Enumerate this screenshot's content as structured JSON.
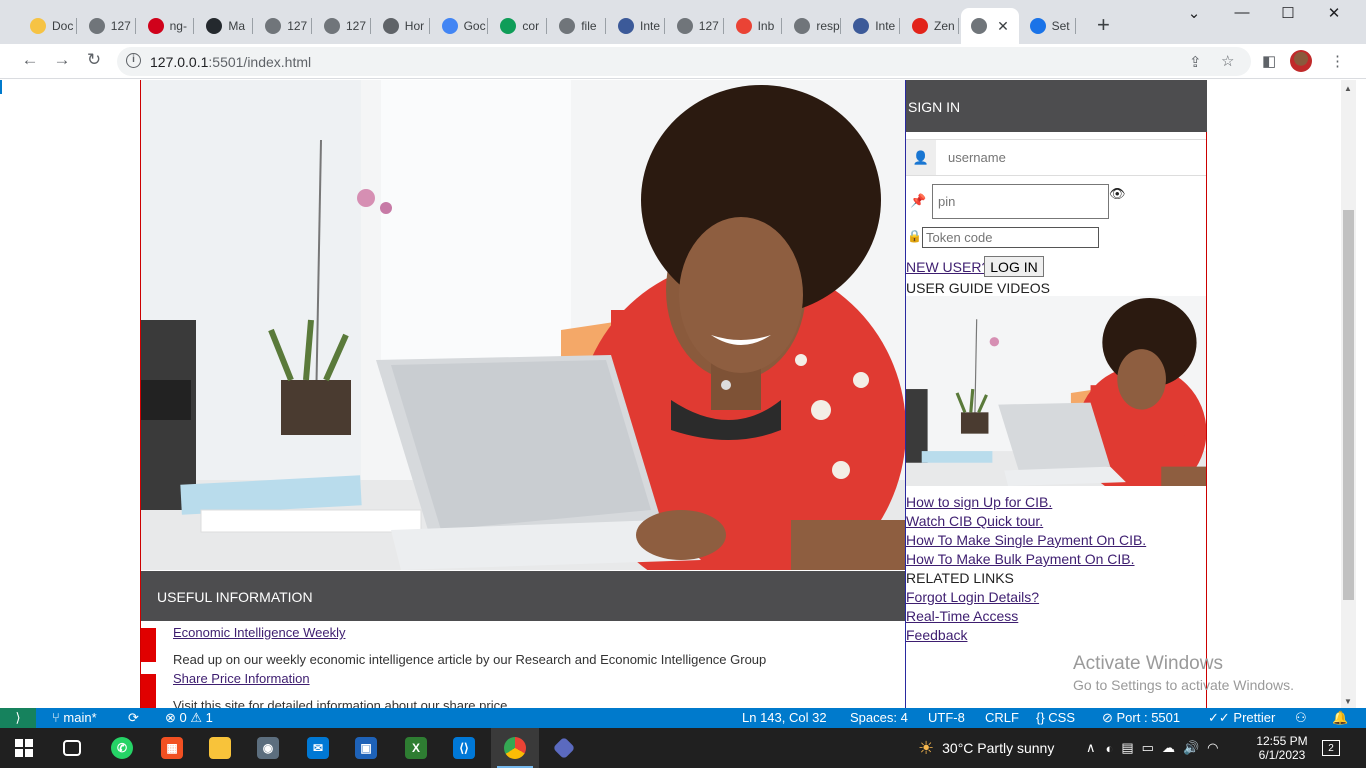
{
  "browser": {
    "tabs": [
      {
        "label": "Doc",
        "color": "#f6c344"
      },
      {
        "label": "127",
        "color": "#70757a"
      },
      {
        "label": "ng-",
        "color": "#d0021b"
      },
      {
        "label": "Ma",
        "color": "#24292e"
      },
      {
        "label": "127",
        "color": "#70757a"
      },
      {
        "label": "127",
        "color": "#70757a"
      },
      {
        "label": "Hor",
        "color": "#5f6368"
      },
      {
        "label": "Goc",
        "color": "#4285f4"
      },
      {
        "label": "cor",
        "color": "#0f9d58"
      },
      {
        "label": "file",
        "color": "#70757a"
      },
      {
        "label": "Inte",
        "color": "#3c5a99"
      },
      {
        "label": "127",
        "color": "#70757a"
      },
      {
        "label": "Inb",
        "color": "#ea4335"
      },
      {
        "label": "resp",
        "color": "#70757a"
      },
      {
        "label": "Inte",
        "color": "#3c5a99"
      },
      {
        "label": "Zen",
        "color": "#e2231a"
      },
      {
        "label": "",
        "color": "#70757a"
      },
      {
        "label": "Set",
        "color": "#1a73e8"
      }
    ],
    "tab_close_glyph": "✕",
    "new_tab_glyph": "+",
    "url_host": "127.0.0.1",
    "url_rest": ":5501/index.html"
  },
  "page": {
    "signin_title": "SIGN IN",
    "username_placeholder": "username",
    "pin_placeholder": "pin",
    "token_placeholder": "Token code",
    "new_user_link": "NEW USER?",
    "login_button": "LOG IN",
    "user_guide_label": "USER GUIDE VIDEOS",
    "guide_links": [
      "How to sign Up for CIB.",
      "Watch CIB Quick tour.",
      "How To Make Single Payment On CIB.",
      "How To Make Bulk Payment On CIB."
    ],
    "related_label": "RELATED LINKS",
    "related_links": [
      "Forgot Login Details?",
      "Real-Time Access",
      "Feedback"
    ],
    "useful_title": "USEFUL INFORMATION",
    "useful_items": [
      {
        "link": "Economic Intelligence Weekly",
        "text": "Read up on our weekly economic intelligence article by our Research and Economic Intelligence Group"
      },
      {
        "link": "Share Price Information",
        "text": "Visit this site for detailed information about our share price"
      }
    ]
  },
  "watermark": {
    "line1": "Activate Windows",
    "line2": "Go to Settings to activate Windows."
  },
  "statusbar": {
    "branch": "main*",
    "problems": "⊗ 0 ⚠ 1",
    "position": "Ln 143, Col 32",
    "spaces": "Spaces: 4",
    "encoding": "UTF-8",
    "eol": "CRLF",
    "language": "CSS",
    "port": "Port : 5501",
    "formatter": "Prettier"
  },
  "taskbar": {
    "weather": "30°C  Partly sunny",
    "time": "12:55 PM",
    "date": "6/1/2023",
    "notifications": "2"
  },
  "colors": {
    "header_dark": "#4d4d4f",
    "accent_red": "#e00000",
    "link_purple": "#3e1e70",
    "vscode_blue": "#007acc"
  }
}
